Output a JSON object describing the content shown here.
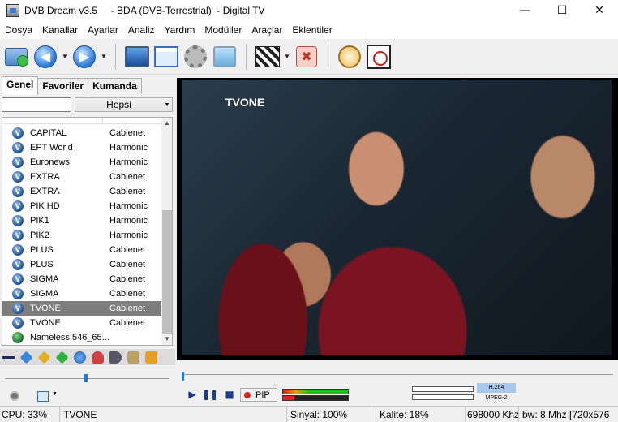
{
  "window": {
    "title": "DVB Dream v3.5     - BDA (DVB-Terrestrial)  - Digital TV",
    "minimize": "—",
    "maximize": "☐",
    "close": "✕"
  },
  "menu": [
    "Dosya",
    "Kanallar",
    "Ayarlar",
    "Analiz",
    "Yardım",
    "Modüller",
    "Araçlar",
    "Eklentiler"
  ],
  "toolbar": {
    "icons": [
      "open-folder-icon",
      "back-icon",
      "forward-icon",
      "monitor-icon",
      "window-icon",
      "gear-icon",
      "tv-icon",
      "clapperboard-icon",
      "cancel-icon",
      "stopwatch-icon",
      "clock-icon"
    ]
  },
  "tabs": [
    "Genel",
    "Favoriler",
    "Kumanda"
  ],
  "filter": {
    "input_value": "",
    "combo_value": "Hepsi"
  },
  "channels": [
    {
      "name": "CAPITAL",
      "provider": "Cablenet",
      "icon": "v"
    },
    {
      "name": "EPT World",
      "provider": "Harmonic",
      "icon": "v"
    },
    {
      "name": "Euronews",
      "provider": "Harmonic",
      "icon": "v"
    },
    {
      "name": "EXTRA",
      "provider": "Cablenet",
      "icon": "v"
    },
    {
      "name": "EXTRA",
      "provider": "Cablenet",
      "icon": "v"
    },
    {
      "name": "PIK HD",
      "provider": "Harmonic",
      "icon": "v"
    },
    {
      "name": "PIK1",
      "provider": "Harmonic",
      "icon": "v"
    },
    {
      "name": "PIK2",
      "provider": "Harmonic",
      "icon": "v"
    },
    {
      "name": "PLUS",
      "provider": "Cablenet",
      "icon": "v"
    },
    {
      "name": "PLUS",
      "provider": "Cablenet",
      "icon": "v"
    },
    {
      "name": "SIGMA",
      "provider": "Cablenet",
      "icon": "v"
    },
    {
      "name": "SIGMA",
      "provider": "Cablenet",
      "icon": "v"
    },
    {
      "name": "TVONE",
      "provider": "Cablenet",
      "icon": "v",
      "selected": true
    },
    {
      "name": "TVONE",
      "provider": "Cablenet",
      "icon": "v"
    },
    {
      "name": "Nameless 546_65...",
      "provider": "",
      "icon": "globe"
    }
  ],
  "video": {
    "logo": "TVONE"
  },
  "playback": {
    "pip_label": "PIP",
    "signal_level": 1.0,
    "quality_level": 0.18,
    "codec_video": "H.264",
    "codec_audio": "MPEG-2"
  },
  "status": {
    "cpu": "CPU: 33%",
    "channel": "TVONE",
    "signal": "Sinyal: 100%",
    "quality": "Kalite: 18%",
    "frequency": "698000 Khz",
    "bandwidth": "bw: 8 Mhz [720x576"
  },
  "colors": {
    "accent": "#1e78d8",
    "selection": "#7d7d7d",
    "rec": "#e02020"
  }
}
